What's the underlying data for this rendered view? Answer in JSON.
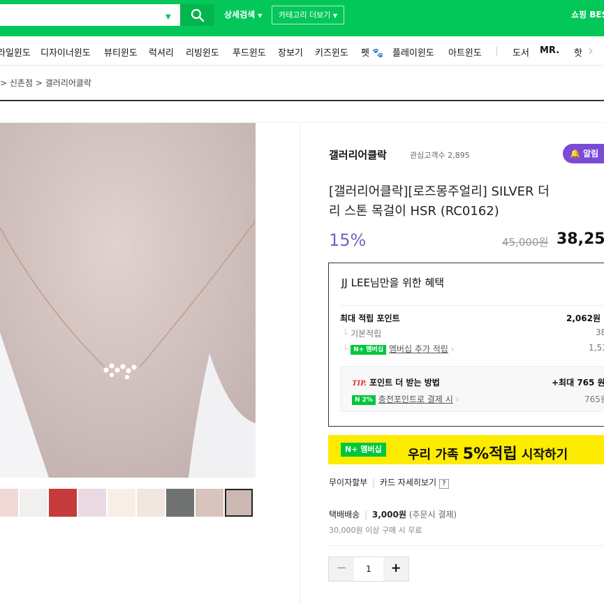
{
  "header": {
    "detail_search": "상세검색",
    "category_more": "카테고리 더보기",
    "shopping_best": "쇼핑 BES"
  },
  "nav": {
    "items": [
      "라일윈도",
      "디자이너윈도",
      "뷰티윈도",
      "럭셔리",
      "리빙윈도",
      "푸드윈도",
      "장보기",
      "키즈윈도",
      "펫",
      "플레이윈도",
      "아트윈도",
      "도서",
      "MR.",
      "핫"
    ]
  },
  "breadcrumb": {
    "parent": "신촌점",
    "current": "갤러리어클락"
  },
  "store": {
    "name": "갤러리어클락",
    "fav_label": "관심고객수",
    "fav_count": "2,895",
    "alarm_label": "알림"
  },
  "product": {
    "title_line1": "[갤러리어클락][로즈몽주얼리] SILVER 더",
    "title_line2": "리 스톤 목걸이 HSR (RC0162)",
    "discount": "15%",
    "original_price": "45,000원",
    "sale_price": "38,25"
  },
  "benefits": {
    "title": "JJ LEE님만을 위한 혜택",
    "max_points_label": "최대 적립 포인트",
    "max_points_value": "2,062원",
    "basic_label": "기본적립",
    "basic_value": "38",
    "membership_badge": "N+ 멤버십",
    "membership_label": "멤버십 추가 적립",
    "membership_value": "1,53",
    "tip_title": "TIP.",
    "tip_label": "포인트 더 받는 방법",
    "tip_max": "+최대 765 원",
    "charge_badge": "N 2%",
    "charge_label": "충전포인트로 결제 시",
    "charge_value": "765원"
  },
  "banner": {
    "badge": "N+ 멤버십",
    "text_prefix": "우리 가족",
    "text_highlight": "5%적립",
    "text_suffix": "시작하기"
  },
  "payment": {
    "installment": "무이자할부",
    "card_detail": "카드 자세히보기",
    "help": "?"
  },
  "shipping": {
    "label": "택배배송",
    "fee": "3,000원",
    "note": "(주문시 결제)",
    "free_note": "30,000원 이상 구매 시 무료"
  },
  "quantity": {
    "minus": "−",
    "value": "1",
    "plus": "+"
  },
  "colors": {
    "brand_green": "#04c75a",
    "accent_purple": "#7b4bd6",
    "banner_yellow": "#fdeb00"
  }
}
